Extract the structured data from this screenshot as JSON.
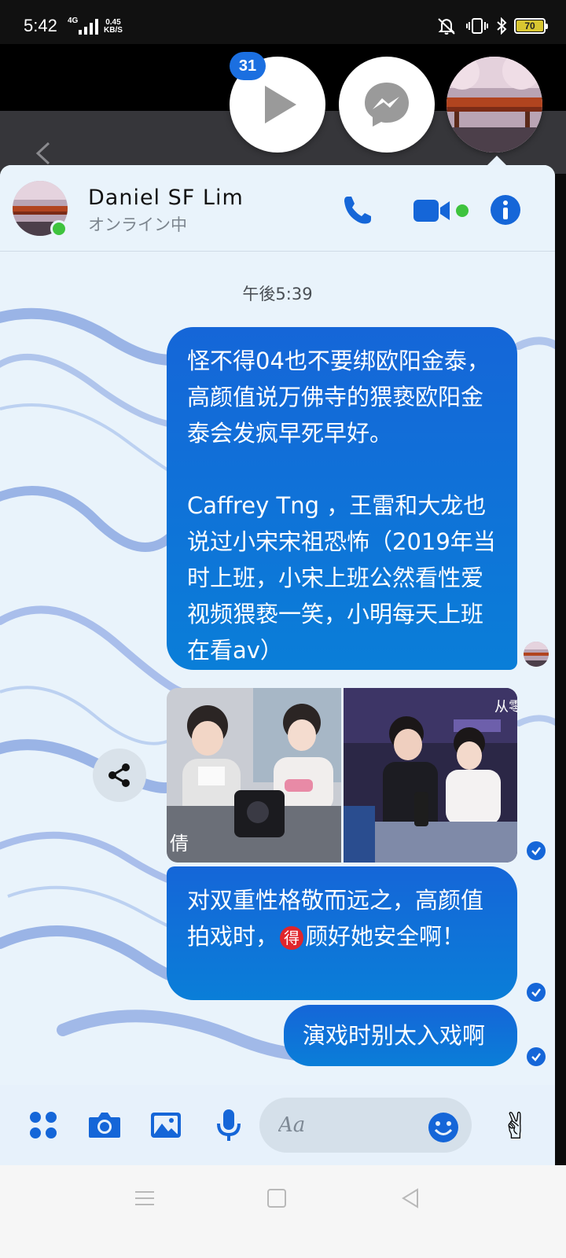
{
  "status_bar": {
    "time": "5:42",
    "network": "4G",
    "speed_value": "0.45",
    "speed_unit": "KB/S",
    "battery": "70"
  },
  "chat_heads": {
    "badge_count": "31"
  },
  "header": {
    "contact_name": "Daniel SF Lim",
    "status": "オンライン中"
  },
  "thread": {
    "timestamp": "午後5:39",
    "messages": [
      "怪不得04也不要绑欧阳金泰，高颜值说万佛寺的猥亵欧阳金泰会发疯早死早好。\n\nCaffrey Tng ，王雷和大龙也说过小宋宋祖恐怖（2019年当时上班，小宋上班公然看性爱视频猥亵一笑，小明每天上班在看av）",
      "对双重性格敬而远之，高颜值拍戏时，",
      "顾好她安全啊！",
      "演戏时别太入戏啊"
    ],
    "emoji_char": "得",
    "photo_caption_left": "倩",
    "photo_caption_right": "从零"
  },
  "composer": {
    "placeholder": "Aa",
    "quick_reaction": "✌"
  },
  "colors": {
    "accent": "#1566d8",
    "online": "#3ec33e",
    "battery": "#d8c631"
  }
}
